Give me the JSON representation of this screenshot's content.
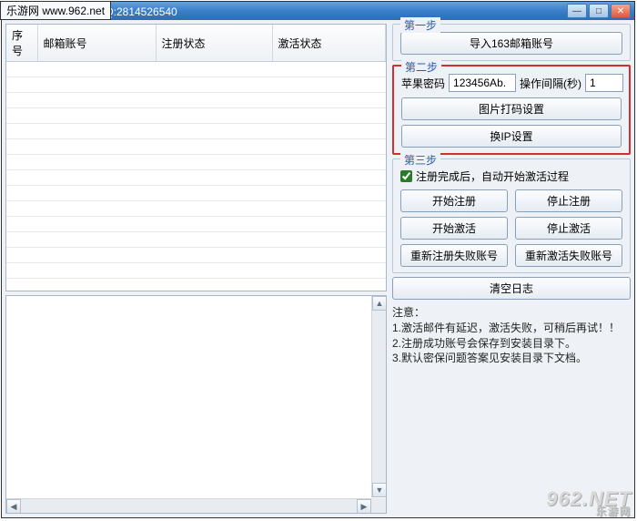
{
  "watermarks": {
    "topLeft": "乐游网 www.962.net",
    "bottomRight": "962.NET",
    "bottomRightSub": "乐游网"
  },
  "titlebar": {
    "text": "具----软件定做联系QQ:2814526540"
  },
  "table": {
    "columns": [
      "序号",
      "邮箱账号",
      "注册状态",
      "激活状态"
    ]
  },
  "step1": {
    "title": "第一步",
    "importBtn": "导入163邮箱账号"
  },
  "step2": {
    "title": "第二步",
    "pwdLabel": "苹果密码",
    "pwdValue": "123456Ab.",
    "intervalLabel": "操作间隔(秒)",
    "intervalValue": "1",
    "captchaBtn": "图片打码设置",
    "ipBtn": "换IP设置"
  },
  "step3": {
    "title": "第三步",
    "autoActivateLabel": "注册完成后，自动开始激活过程",
    "startRegBtn": "开始注册",
    "stopRegBtn": "停止注册",
    "startActBtn": "开始激活",
    "stopActBtn": "停止激活",
    "retryRegBtn": "重新注册失败账号",
    "retryActBtn": "重新激活失败账号"
  },
  "clearLogBtn": "清空日志",
  "notes": {
    "header": "注意：",
    "line1": "1.激活邮件有延迟，激活失败，可稍后再试！！",
    "line2": "2.注册成功账号会保存到安装目录下。",
    "line3": "3.默认密保问题答案见安装目录下文档。"
  }
}
